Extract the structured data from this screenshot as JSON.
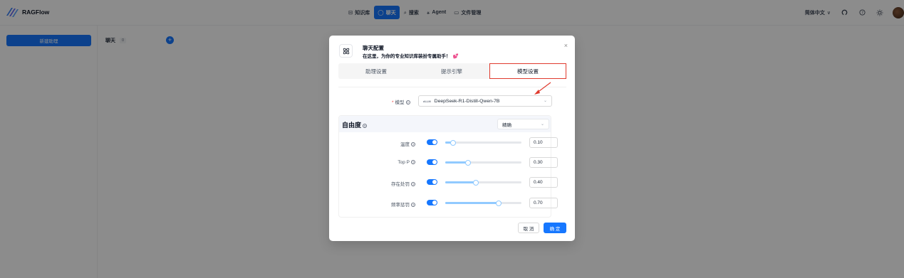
{
  "app": {
    "brand": "RAGFlow"
  },
  "nav": [
    {
      "icon": "database-icon",
      "glyph": "⊟",
      "label": "知识库",
      "active": false
    },
    {
      "icon": "chat-icon",
      "glyph": "◯",
      "label": "聊天",
      "active": true
    },
    {
      "icon": "search-icon",
      "glyph": "⌕",
      "label": "搜索",
      "active": false
    },
    {
      "icon": "agent-icon",
      "glyph": "⚹",
      "label": "Agent",
      "active": false
    },
    {
      "icon": "folder-icon",
      "glyph": "▭",
      "label": "文件管理",
      "active": false
    }
  ],
  "header_right": {
    "language": "简体中文",
    "chevron": "∨"
  },
  "background": {
    "new_button": "新建助理",
    "chat_tab": "聊天",
    "chat_count": "0",
    "plus": "+"
  },
  "modal": {
    "title": "聊天配置",
    "subtitle": "在这里，为你的专业知识库装扮专属助手！",
    "heart": "💕",
    "close": "×",
    "tabs": [
      {
        "label": "助理设置",
        "active": false
      },
      {
        "label": "提示引擎",
        "active": false
      },
      {
        "label": "模型设置",
        "active": true
      }
    ],
    "model": {
      "required_mark": "*",
      "label": "模型",
      "vendor": "dLLM",
      "value": "DeepSeek-R1-Distill-Qwen-7B",
      "chevron": "⌄"
    },
    "freedom": {
      "title": "自由度",
      "preset": "精确",
      "chevron": "⌄",
      "params": [
        {
          "label": "温度",
          "enabled": true,
          "value": "0.10",
          "ratio": 0.1
        },
        {
          "label": "Top P",
          "enabled": true,
          "value": "0.30",
          "ratio": 0.3
        },
        {
          "label": "存在处罚",
          "enabled": true,
          "value": "0.40",
          "ratio": 0.4
        },
        {
          "label": "频率惩罚",
          "enabled": true,
          "value": "0.70",
          "ratio": 0.7
        }
      ]
    },
    "cancel": "取 消",
    "ok": "确 定"
  },
  "colors": {
    "primary": "#1677ff",
    "annotation": "#e03b2e",
    "slider": "#91caff"
  }
}
